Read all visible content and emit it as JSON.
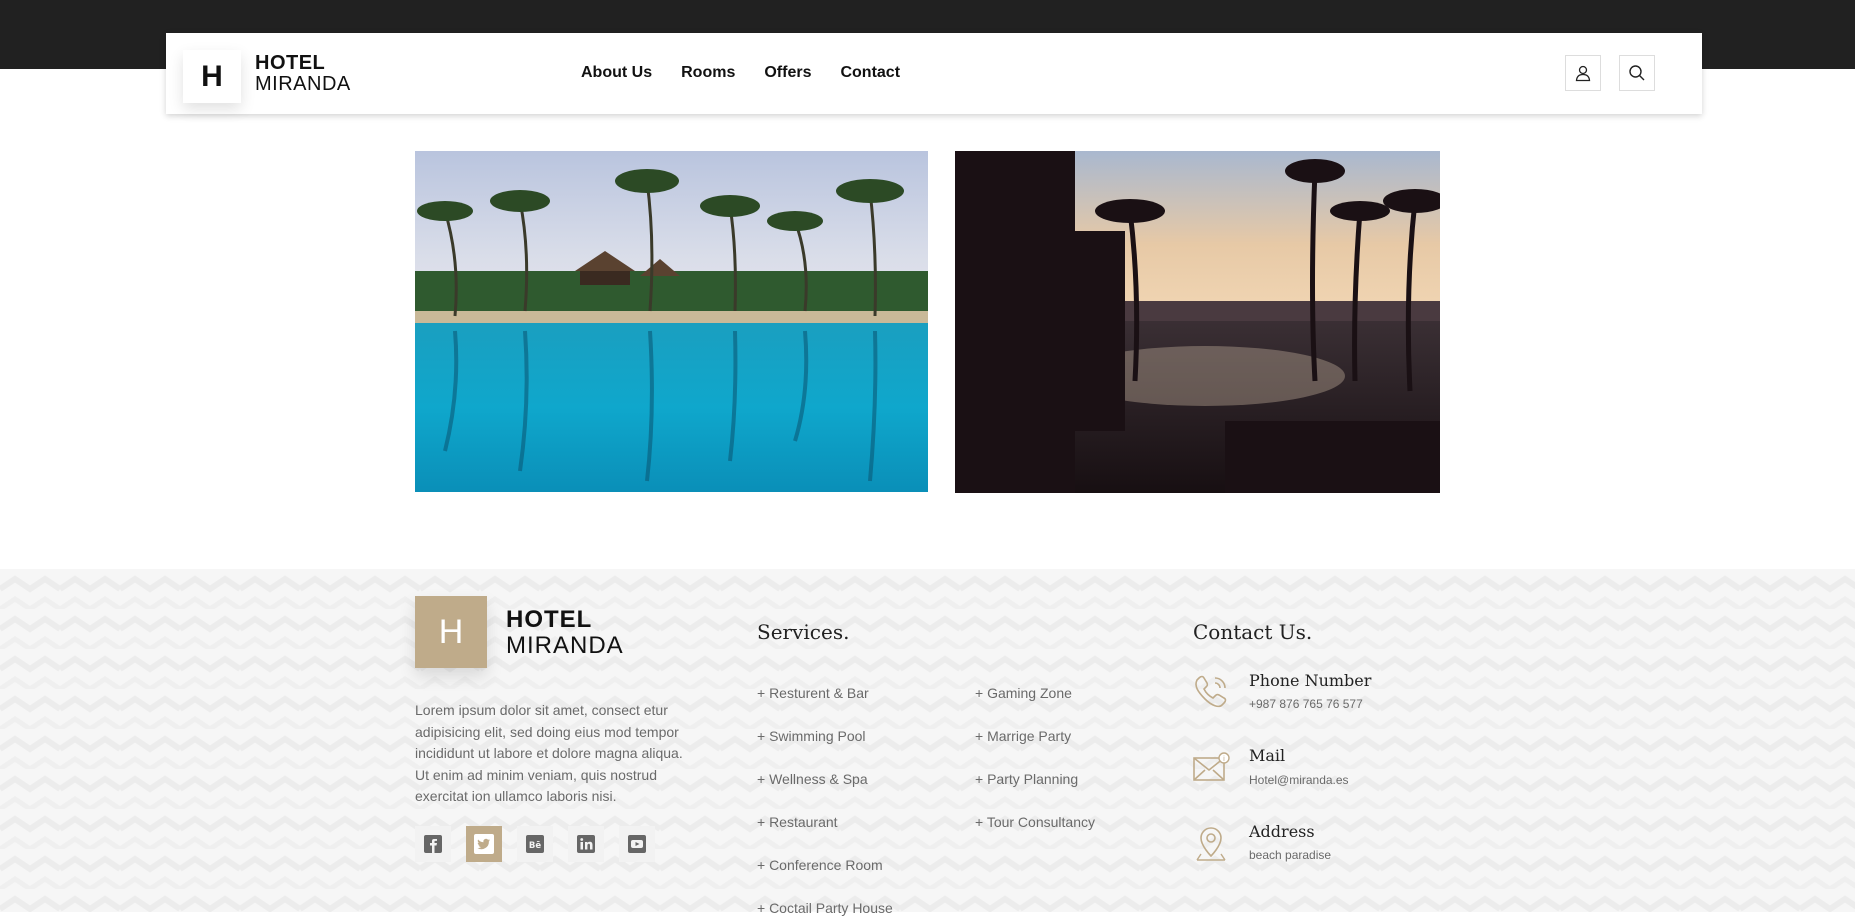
{
  "brand": {
    "logo_letter": "H",
    "line1": "HOTEL",
    "line2": "MIRANDA"
  },
  "nav": {
    "items": [
      "About Us",
      "Rooms",
      "Offers",
      "Contact"
    ]
  },
  "header_icons": [
    "user-icon",
    "search-icon"
  ],
  "gallery": [
    {
      "name": "pool-palms-image"
    },
    {
      "name": "sunset-palms-image"
    }
  ],
  "footer": {
    "logo_letter": "H",
    "line1": "HOTEL",
    "line2": "MIRANDA",
    "about": "Lorem ipsum dolor sit amet, consect etur adipisicing elit, sed doing eius mod tempor incididunt ut labore et dolore magna aliqua. Ut enim ad minim veniam, quis nostrud exercitat ion ullamco laboris nisi.",
    "socials": [
      "facebook-icon",
      "twitter-icon",
      "behance-icon",
      "linkedin-icon",
      "youtube-icon"
    ],
    "services_title": "Services.",
    "services_col1": [
      "+ Resturent & Bar",
      "+ Swimming Pool",
      "+ Wellness & Spa",
      "+ Restaurant",
      "+ Conference Room",
      "+ Coctail Party House"
    ],
    "services_col2": [
      "+ Gaming Zone",
      "+ Marrige Party",
      "+ Party Planning",
      "+ Tour Consultancy"
    ],
    "contact_title": "Contact Us.",
    "contact": [
      {
        "title": "Phone Number",
        "value": "+987 876 765 76 577",
        "icon": "phone-icon"
      },
      {
        "title": "Mail",
        "value": "Hotel@miranda.es",
        "icon": "mail-icon"
      },
      {
        "title": "Address",
        "value": "beach paradise",
        "icon": "location-icon"
      }
    ]
  },
  "colors": {
    "accent": "#bfab8a",
    "topbar": "#212121"
  }
}
